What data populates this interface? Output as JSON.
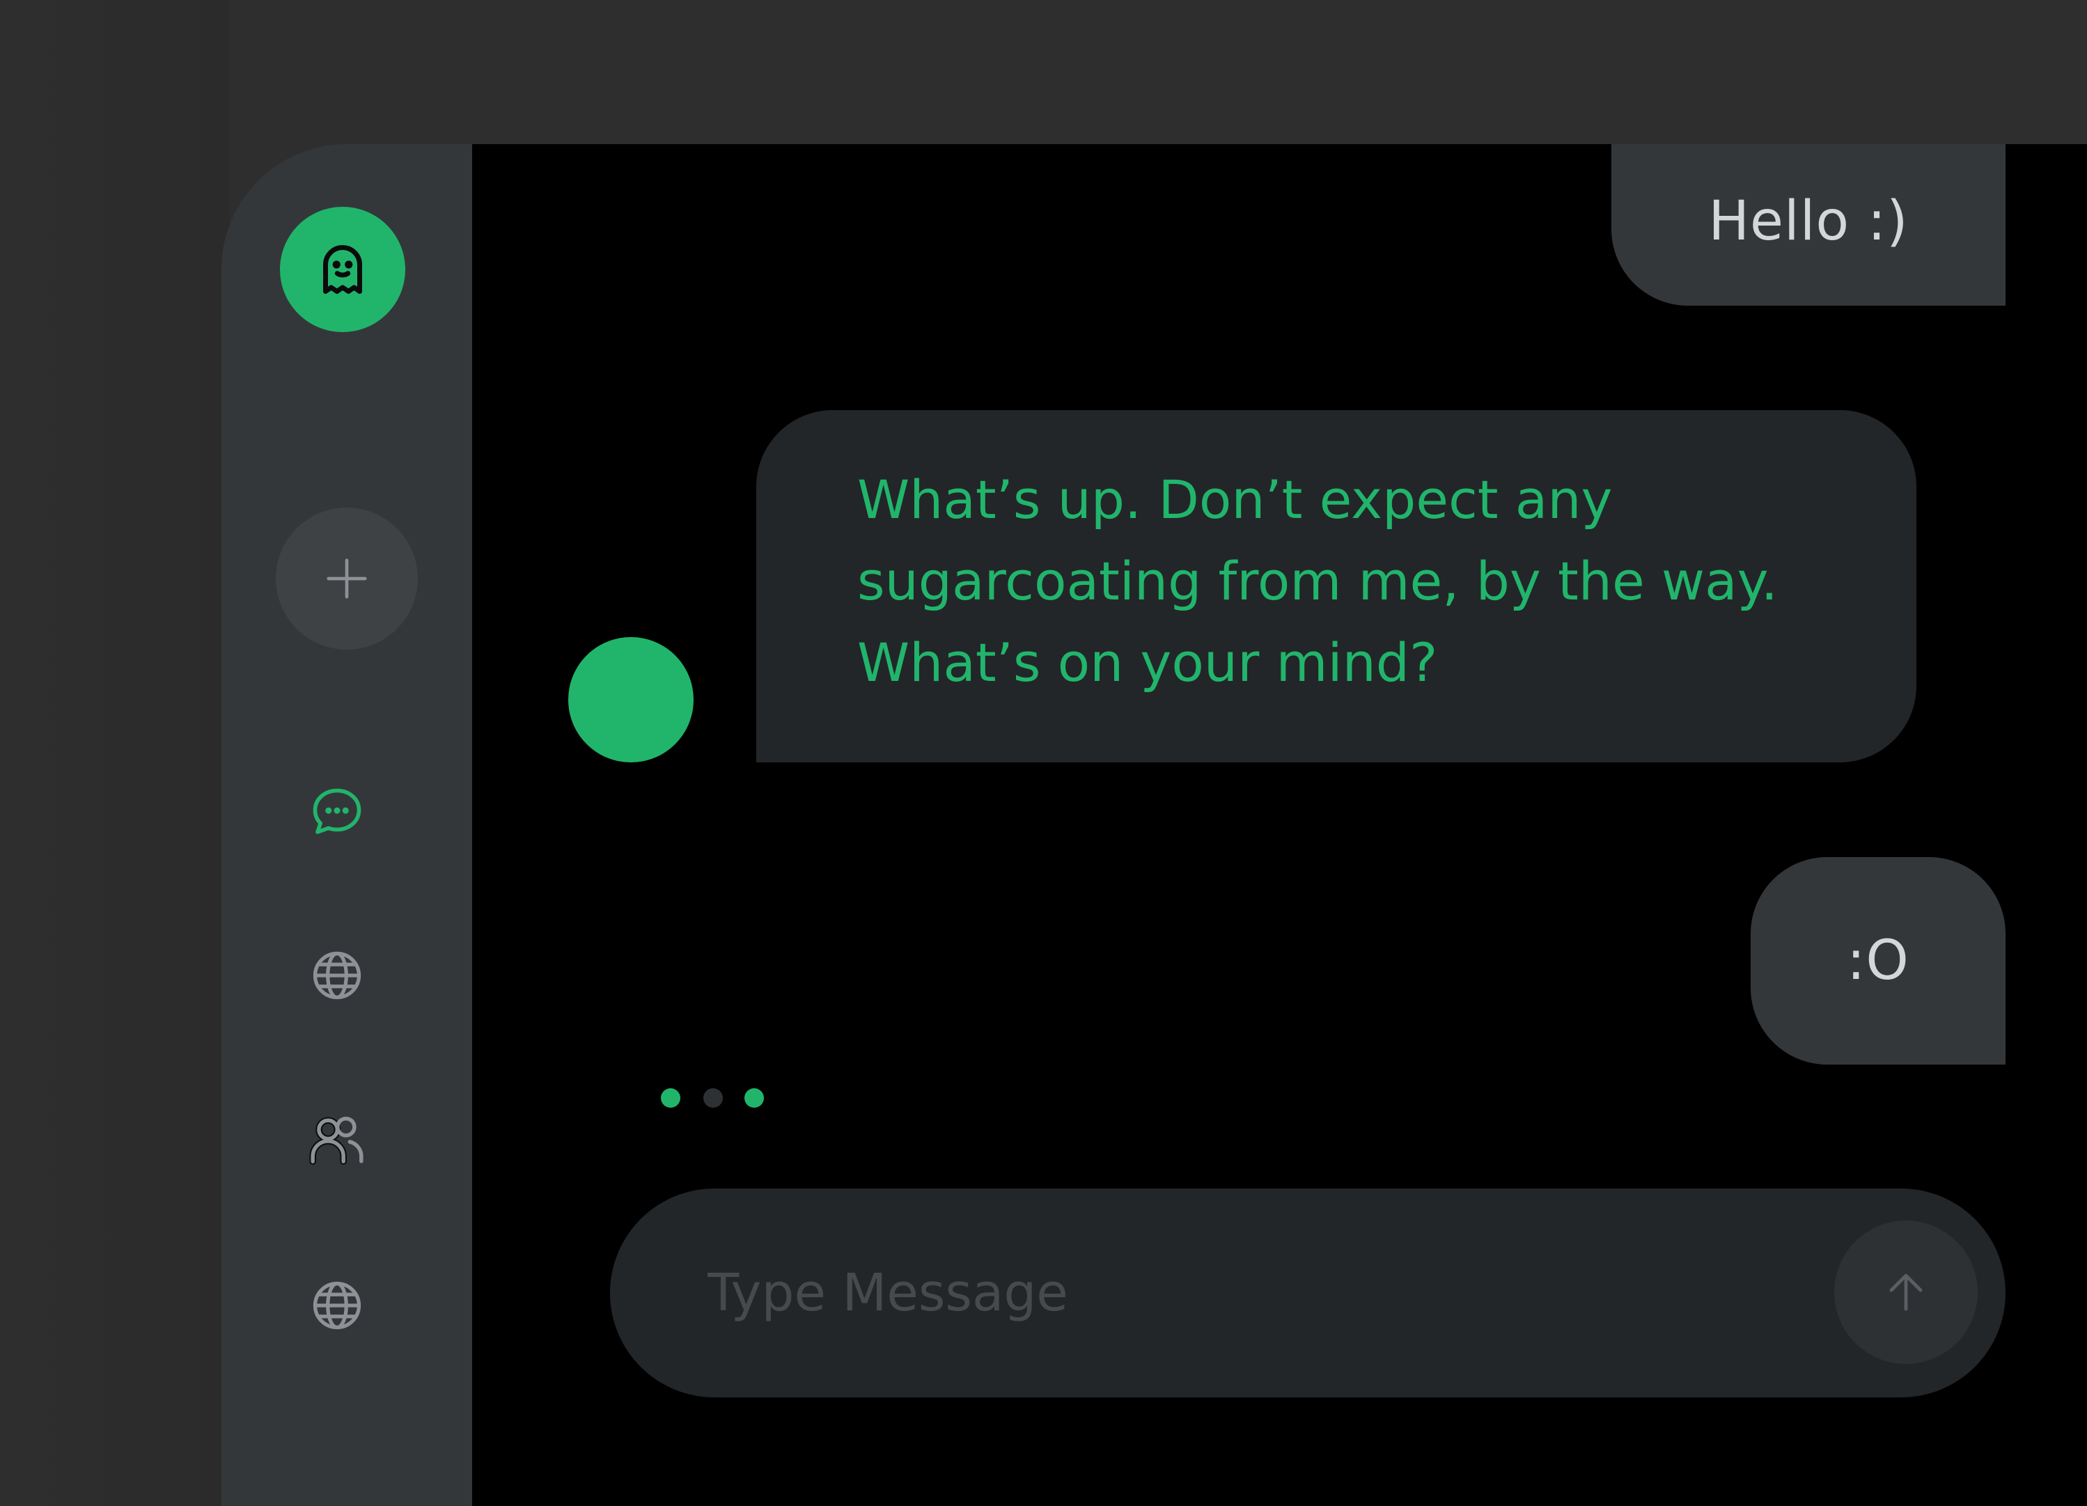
{
  "sidebar": {
    "logo_icon": "ghost-icon",
    "new_chat_icon": "plus-icon",
    "nav_items": [
      {
        "icon": "chat-bubble-icon",
        "active": true
      },
      {
        "icon": "globe-icon",
        "active": false
      },
      {
        "icon": "users-icon",
        "active": false
      },
      {
        "icon": "globe-icon",
        "active": false
      }
    ]
  },
  "messages": [
    {
      "role": "user",
      "text": "Hello :)"
    },
    {
      "role": "bot",
      "lines": [
        "What’s up. Don’t expect any",
        "sugarcoating from me, by the way.",
        "What’s on your mind?"
      ]
    },
    {
      "role": "user",
      "text": ":O"
    }
  ],
  "composer": {
    "placeholder": "Type Message",
    "value": "",
    "send_icon": "arrow-up-icon"
  },
  "colors": {
    "accent": "#21b56c",
    "panel": "#34373a",
    "bubble_bot": "#232628",
    "background": "#000000"
  }
}
